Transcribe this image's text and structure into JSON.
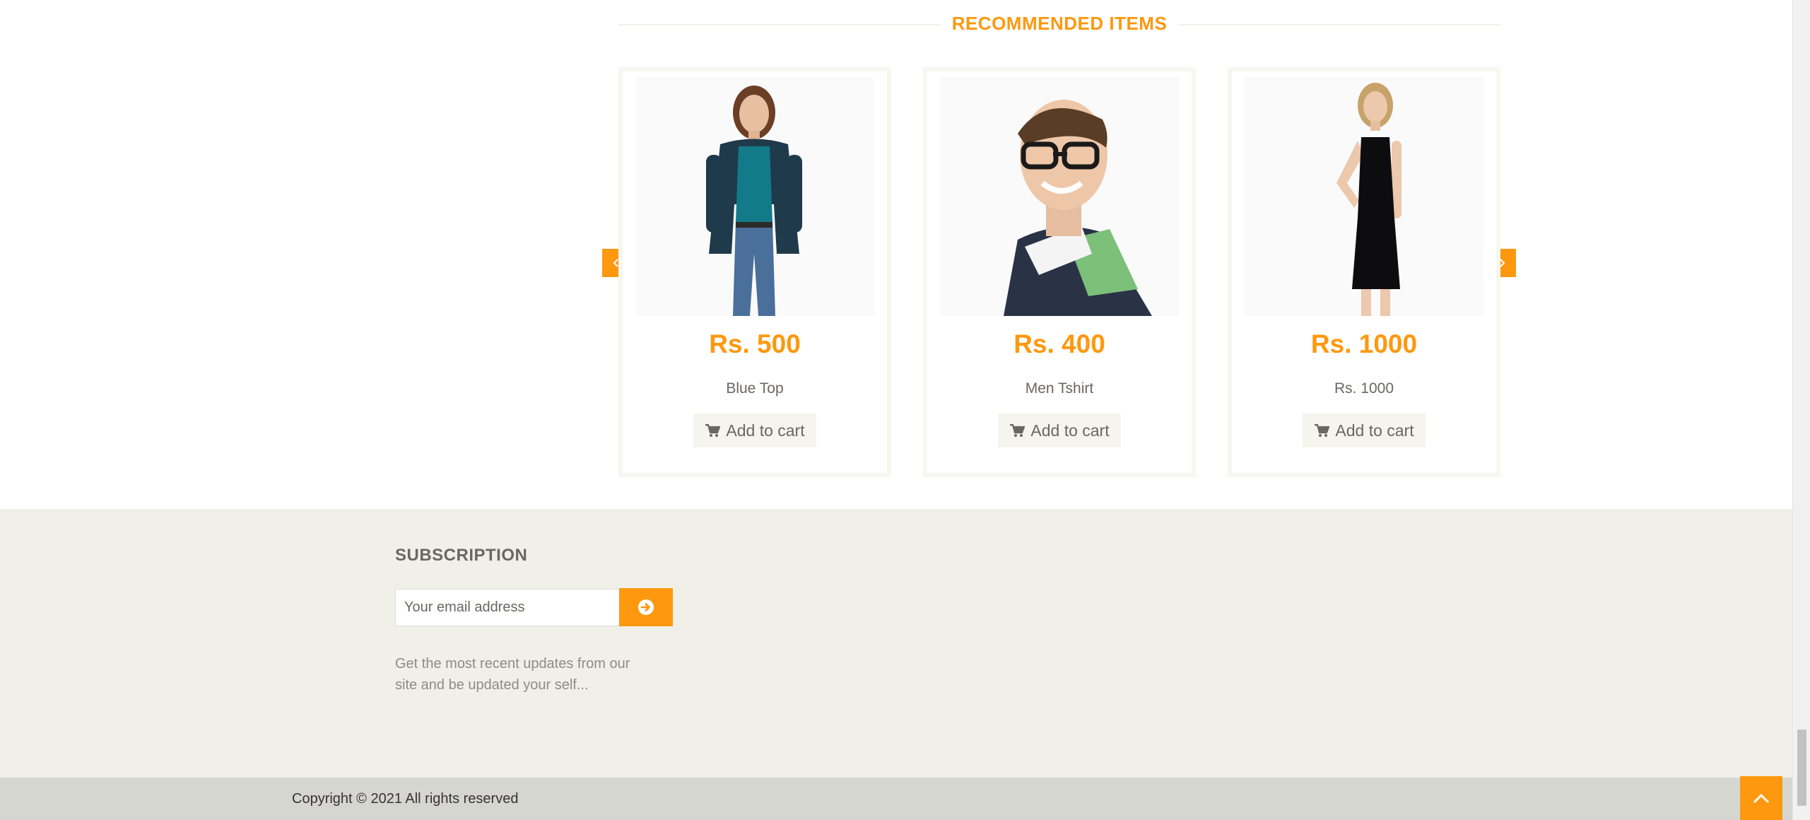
{
  "recommended": {
    "title": "RECOMMENDED ITEMS",
    "products": [
      {
        "price": "Rs. 500",
        "name": "Blue Top",
        "button": "Add to cart",
        "image": "woman-blue-top"
      },
      {
        "price": "Rs. 400",
        "name": "Men Tshirt",
        "button": "Add to cart",
        "image": "man-tshirt-glasses"
      },
      {
        "price": "Rs. 1000",
        "name": "Rs. 1000",
        "button": "Add to cart",
        "image": "woman-black-dress"
      }
    ],
    "prev_icon": "chevron-left-icon",
    "next_icon": "chevron-right-icon"
  },
  "subscription": {
    "title": "SUBSCRIPTION",
    "placeholder": "Your email address",
    "submit_icon": "arrow-circle-right-icon",
    "description": "Get the most recent updates from our site and be updated your self..."
  },
  "footer": {
    "copyright": "Copyright © 2021 All rights reserved",
    "scroll_top_icon": "chevron-up-icon"
  },
  "colors": {
    "accent": "#FE980F",
    "footer_bg": "#F0F0E9",
    "footer_bottom_bg": "#D6D6D0",
    "text": "#696763"
  }
}
